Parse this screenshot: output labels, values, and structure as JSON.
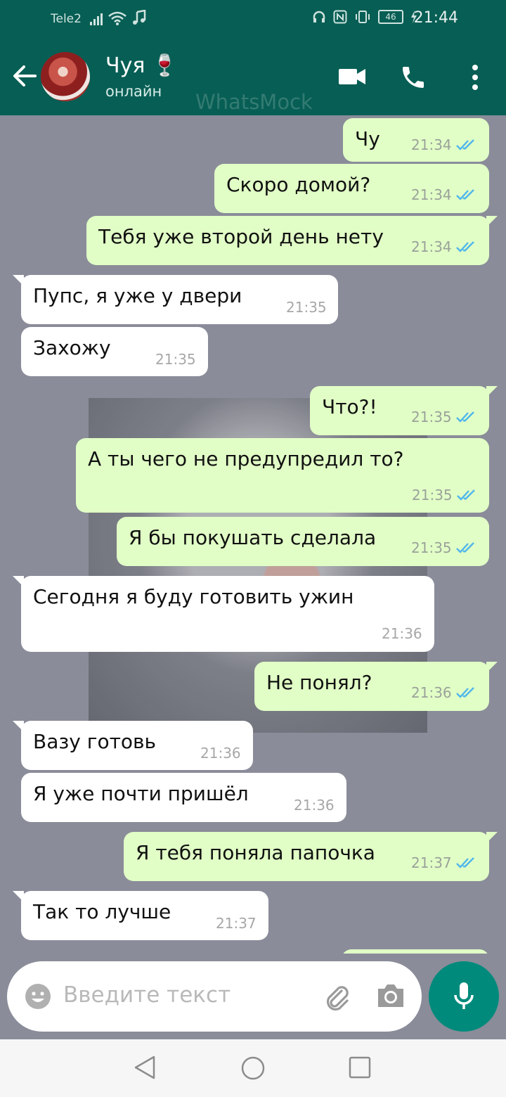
{
  "status_bar": {
    "carrier": "Tele2",
    "battery": "46",
    "time": "21:44"
  },
  "header": {
    "contact_name": "Чуя 🍷",
    "contact_status": "онлайн",
    "watermark": "WhatsMock"
  },
  "messages": [
    {
      "dir": "out",
      "text": "Чу",
      "time": "21:34",
      "read": true
    },
    {
      "dir": "out",
      "text": "Скоро домой?",
      "time": "21:34",
      "read": true
    },
    {
      "dir": "out",
      "text": "Тебя уже второй день нету",
      "time": "21:34",
      "read": true
    },
    {
      "dir": "in",
      "text": "Пупс, я уже у двери",
      "time": "21:35"
    },
    {
      "dir": "in",
      "text": "Захожу",
      "time": "21:35"
    },
    {
      "dir": "out",
      "text": "Что?!",
      "time": "21:35",
      "read": true
    },
    {
      "dir": "out",
      "text": "А ты чего не предупредил то?",
      "time": "21:35",
      "read": true
    },
    {
      "dir": "out",
      "text": "Я бы покушать сделала",
      "time": "21:35",
      "read": true
    },
    {
      "dir": "in",
      "text": "Сегодня я буду готовить ужин",
      "time": "21:36"
    },
    {
      "dir": "out",
      "text": "Не понял?",
      "time": "21:36",
      "read": true
    },
    {
      "dir": "in",
      "text": "Вазу готовь",
      "time": "21:36"
    },
    {
      "dir": "in",
      "text": "Я уже почти пришёл",
      "time": "21:36"
    },
    {
      "dir": "out",
      "text": "Я тебя поняла папочка",
      "time": "21:37",
      "read": true
    },
    {
      "dir": "in",
      "text": "Так то лучше",
      "time": "21:37"
    }
  ],
  "composer": {
    "placeholder": "Введите текст"
  },
  "icons": {
    "header": [
      "back-arrow-icon",
      "video-call-icon",
      "phone-icon",
      "more-vert-icon"
    ],
    "composer": [
      "emoji-icon",
      "attach-icon",
      "camera-icon",
      "mic-icon"
    ],
    "nav": [
      "nav-back-icon",
      "nav-home-icon",
      "nav-recents-icon"
    ]
  },
  "colors": {
    "header_bg": "#075e54",
    "chat_bg": "#8a8c99",
    "bubble_out": "#e1fec6",
    "bubble_in": "#ffffff",
    "read_ticks": "#4fb6ec",
    "mic_button": "#008a7c"
  }
}
